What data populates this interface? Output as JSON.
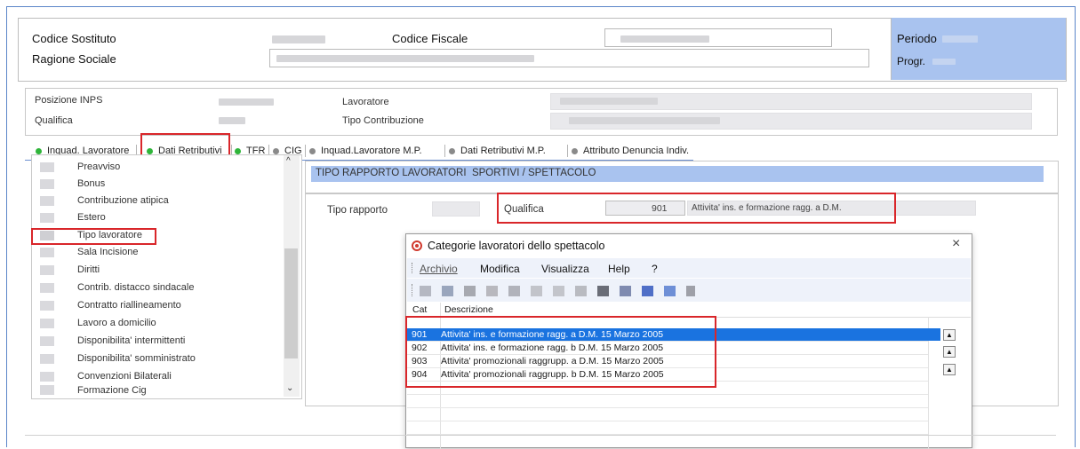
{
  "header": {
    "codice_sostituto_label": "Codice Sostituto",
    "ragione_sociale_label": "Ragione Sociale",
    "codice_fiscale_label": "Codice Fiscale",
    "periodo_label": "Periodo",
    "progr_label": "Progr."
  },
  "worker": {
    "posizione_inps_label": "Posizione INPS",
    "qualifica_label": "Qualifica",
    "lavoratore_label": "Lavoratore",
    "tipo_contribuzione_label": "Tipo Contribuzione"
  },
  "tabs": [
    {
      "label": "Inquad. Lavoratore",
      "status": "green"
    },
    {
      "label": "Dati Retributivi",
      "status": "green",
      "active": true
    },
    {
      "label": "TFR",
      "status": "green"
    },
    {
      "label": "CIG",
      "status": "gray"
    },
    {
      "label": "Inquad.Lavoratore M.P.",
      "status": "gray"
    },
    {
      "label": "Dati Retributivi M.P.",
      "status": "gray"
    },
    {
      "label": "Attributo Denuncia Indiv.",
      "status": "gray"
    }
  ],
  "sidebar": {
    "items": [
      "Preavviso",
      "Bonus",
      "Contribuzione atipica",
      "Estero",
      "Tipo lavoratore",
      "Sala Incisione",
      "Diritti",
      "Contrib. distacco sindacale",
      "Contratto riallineamento",
      "Lavoro a domicilio",
      "Disponibilita' intermittenti",
      "Disponibilita' somministrato",
      "Convenzioni Bilaterali",
      "Formazione Cig"
    ]
  },
  "panel": {
    "title": "TIPO RAPPORTO LAVORATORI  SPORTIVI / SPETTACOLO",
    "tipo_rapporto_label": "Tipo rapporto",
    "qualifica_label": "Qualifica",
    "qualifica_code": "901",
    "qualifica_desc": "Attivita' ins. e formazione ragg. a D.M."
  },
  "dialog": {
    "title": "Categorie lavoratori dello spettacolo",
    "close": "×",
    "menu": [
      "Archivio",
      "Modifica",
      "Visualizza",
      "Help",
      "?"
    ],
    "columns": {
      "cat": "Cat",
      "desc": "Descrizione"
    },
    "rows": [
      {
        "cat": "901",
        "desc": "Attivita' ins. e formazione ragg. a D.M. 15 Marzo 2005",
        "selected": true
      },
      {
        "cat": "902",
        "desc": "Attivita' ins. e formazione ragg. b D.M. 15 Marzo 2005"
      },
      {
        "cat": "903",
        "desc": "Attivita' promozionali raggrupp. a  D.M. 15 Marzo 2005"
      },
      {
        "cat": "904",
        "desc": "Attivita' promozionali raggrupp. b  D.M. 15 Marzo 2005"
      }
    ]
  },
  "colors": {
    "accent_blue": "#5b86c9",
    "panel_blue": "#a9c3ef",
    "selection_blue": "#1a73e0",
    "highlight_red": "#d9262a",
    "status_green": "#2fb53a"
  }
}
